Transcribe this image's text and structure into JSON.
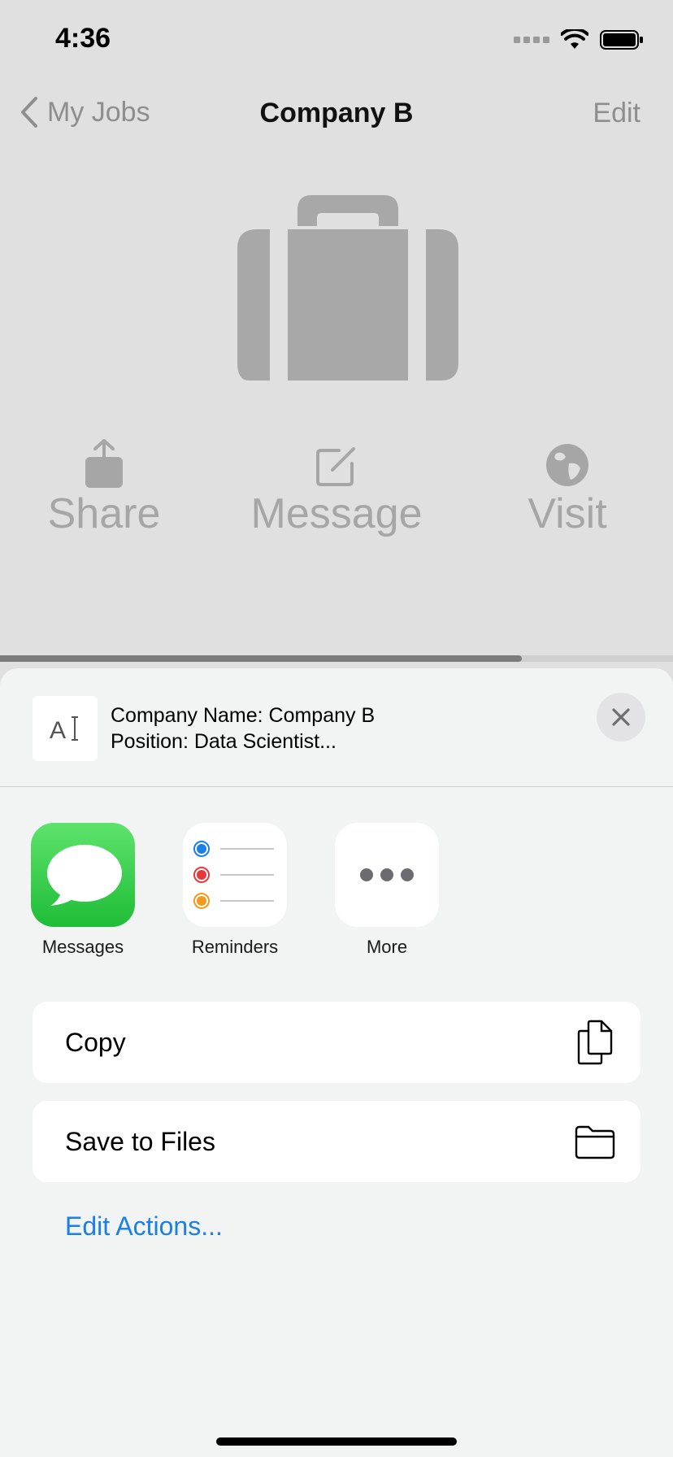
{
  "status_bar": {
    "time": "4:36",
    "icons": [
      "signal-icon",
      "wifi-icon",
      "battery-icon"
    ]
  },
  "nav": {
    "back_label": "My Jobs",
    "title": "Company B",
    "edit_label": "Edit"
  },
  "hero": {
    "icon": "briefcase-icon"
  },
  "actions": [
    {
      "label": "Share",
      "icon": "share-icon"
    },
    {
      "label": "Message",
      "icon": "compose-icon"
    },
    {
      "label": "Visit",
      "icon": "globe-icon"
    }
  ],
  "page_progress": 0.775,
  "share_sheet": {
    "preview_line1": "Company Name: Company B",
    "preview_line2": "Position: Data Scientist...",
    "preview_icon": "text-document-icon",
    "apps": [
      {
        "label": "Messages",
        "icon": "messages-icon"
      },
      {
        "label": "Reminders",
        "icon": "reminders-icon"
      },
      {
        "label": "More",
        "icon": "more-icon"
      }
    ],
    "copy_label": "Copy",
    "save_label": "Save to Files",
    "edit_actions_label": "Edit Actions..."
  },
  "colors": {
    "dimmed_text": "#a6a6a6",
    "link_blue": "#1a7fe6",
    "messages_green": "#1fbd37",
    "sheet_background": "#f2f3f3"
  }
}
